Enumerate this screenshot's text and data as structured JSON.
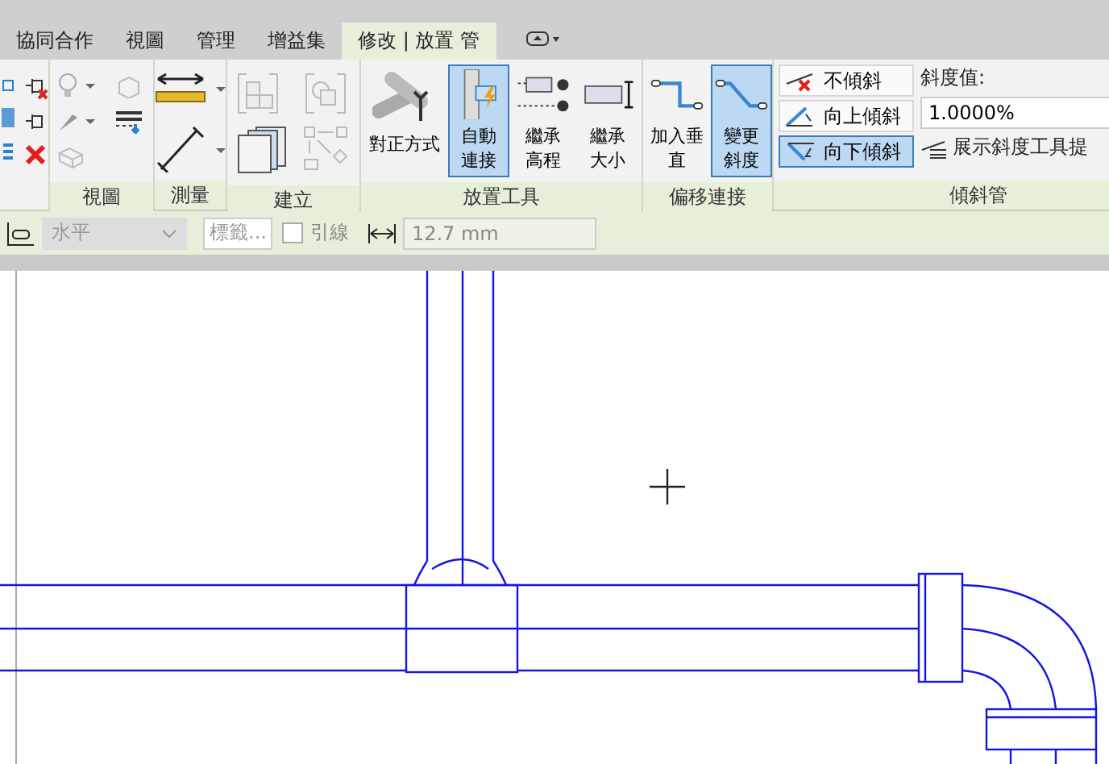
{
  "tabs": [
    {
      "label": "協同合作",
      "selected": false
    },
    {
      "label": "視圖",
      "selected": false
    },
    {
      "label": "管理",
      "selected": false
    },
    {
      "label": "增益集",
      "selected": false
    },
    {
      "label": "修改 | 放置 管",
      "selected": true
    }
  ],
  "panels": {
    "view": {
      "label": "視圖"
    },
    "measure": {
      "label": "測量"
    },
    "create": {
      "label": "建立"
    },
    "placement": {
      "label": "放置工具",
      "tools": [
        {
          "label": "對正方式",
          "selected": false
        },
        {
          "label": "自動連接",
          "selected": true
        },
        {
          "label": "繼承高程",
          "selected": false
        },
        {
          "label": "繼承大小",
          "selected": false
        }
      ]
    },
    "offset": {
      "label": "偏移連接",
      "tools": [
        {
          "label": "加入垂直",
          "selected": false
        },
        {
          "label": "變更斜度",
          "selected": true
        }
      ]
    },
    "slope": {
      "label": "傾斜管",
      "options": [
        {
          "label": "不傾斜",
          "selected": false
        },
        {
          "label": "向上傾斜",
          "selected": false
        },
        {
          "label": "向下傾斜",
          "selected": true
        }
      ],
      "value_label": "斜度值:",
      "value": "1.0000%",
      "tooltip_label": "展示斜度工具提"
    }
  },
  "options_bar": {
    "orientation": {
      "value": "水平",
      "disabled": true
    },
    "tag_button": "標籤...",
    "leader": {
      "label": "引線",
      "checked": false
    },
    "diameter": "12.7 mm"
  }
}
